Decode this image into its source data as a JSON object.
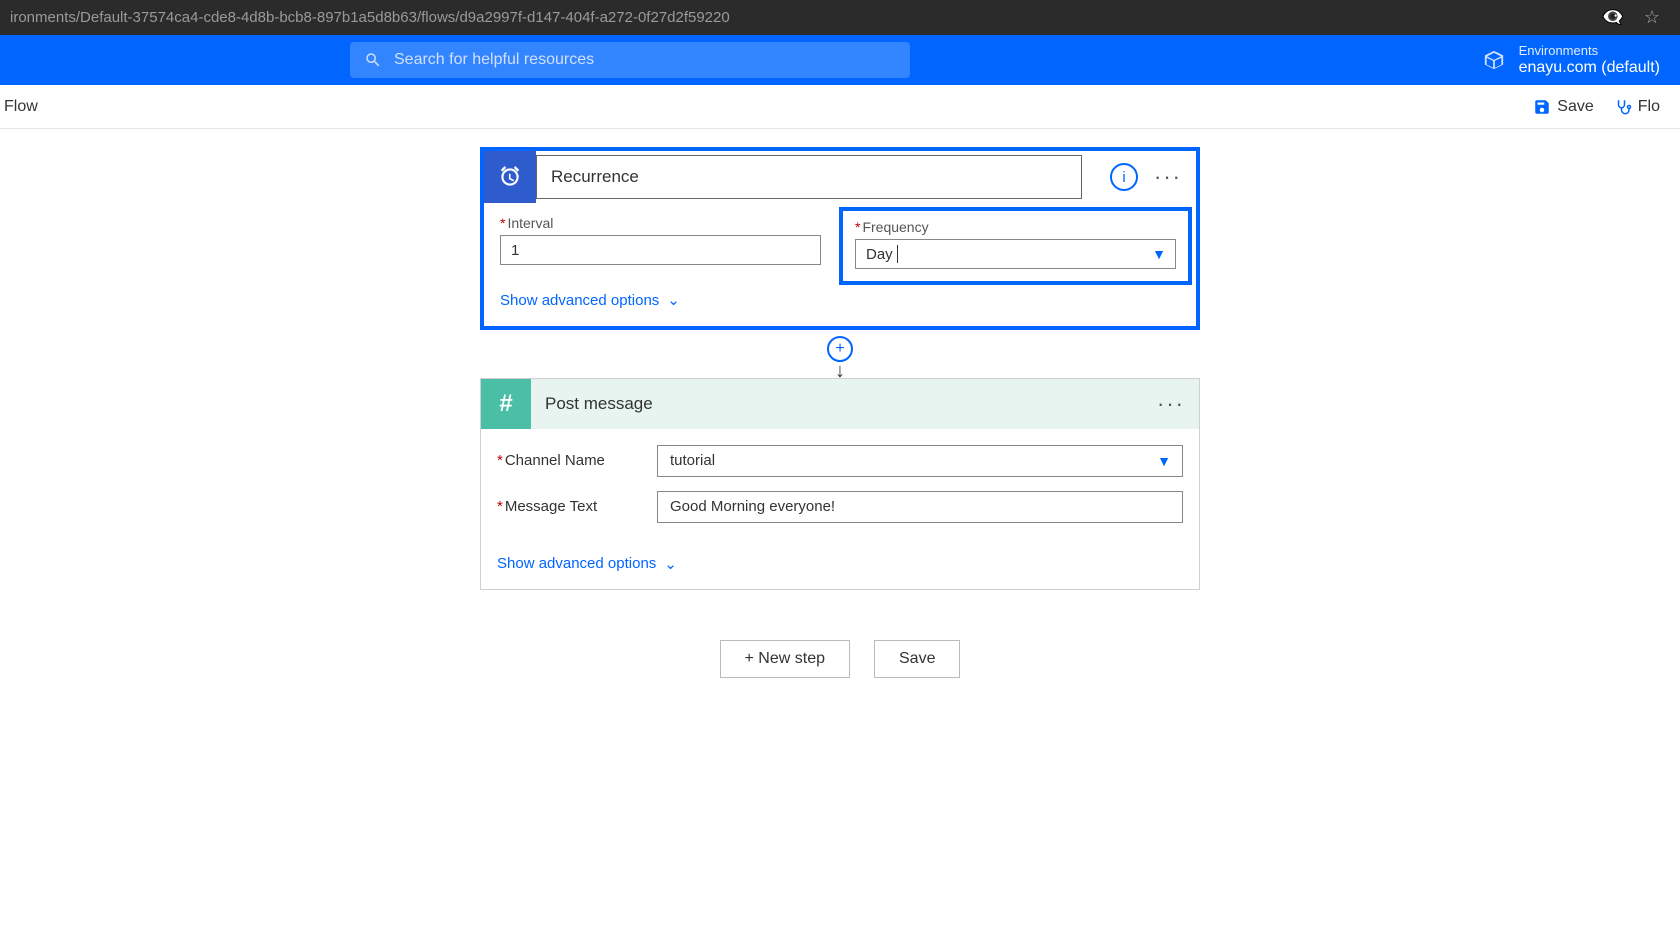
{
  "browser": {
    "url": "ironments/Default-37574ca4-cde8-4d8b-bcb8-897b1a5d8b63/flows/d9a2997f-d147-404f-a272-0f27d2f59220"
  },
  "header": {
    "search_placeholder": "Search for helpful resources",
    "env_label": "Environments",
    "env_name": "enayu.com (default)"
  },
  "command_bar": {
    "flow_label": "Flow",
    "save_label": "Save",
    "flow_checker_label": "Flo"
  },
  "recurrence": {
    "title": "Recurrence",
    "interval_label": "Interval",
    "interval_value": "1",
    "frequency_label": "Frequency",
    "frequency_value": "Day",
    "advanced": "Show advanced options"
  },
  "post_message": {
    "title": "Post message",
    "channel_label": "Channel Name",
    "channel_value": "tutorial",
    "message_label": "Message Text",
    "message_value": "Good Morning everyone!",
    "advanced": "Show advanced options"
  },
  "actions": {
    "new_step": "+ New step",
    "save": "Save"
  }
}
